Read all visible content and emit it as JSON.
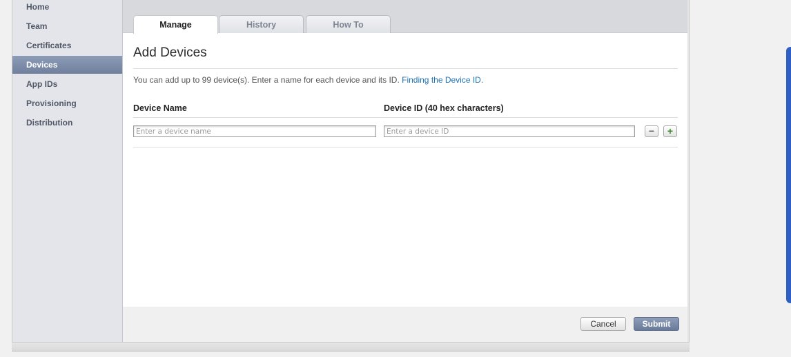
{
  "sidebar": {
    "items": [
      {
        "label": "Home",
        "active": false
      },
      {
        "label": "Team",
        "active": false
      },
      {
        "label": "Certificates",
        "active": false
      },
      {
        "label": "Devices",
        "active": true
      },
      {
        "label": "App IDs",
        "active": false
      },
      {
        "label": "Provisioning",
        "active": false
      },
      {
        "label": "Distribution",
        "active": false
      }
    ]
  },
  "tabs": [
    {
      "label": "Manage",
      "active": true
    },
    {
      "label": "History",
      "active": false
    },
    {
      "label": "How To",
      "active": false
    }
  ],
  "page": {
    "title": "Add Devices",
    "help_text": "You can add up to 99 device(s). Enter a name for each device and its ID. ",
    "help_link": "Finding the Device ID",
    "help_after": "."
  },
  "form": {
    "device_name_header": "Device Name",
    "device_id_header": "Device ID (40 hex characters)",
    "device_name_placeholder": "Enter a device name",
    "device_id_placeholder": "Enter a device ID",
    "device_name_value": "",
    "device_id_value": "",
    "remove_symbol": "−",
    "add_symbol": "+"
  },
  "footer": {
    "cancel_label": "Cancel",
    "submit_label": "Submit"
  },
  "colors": {
    "accent": "#6f7f9d",
    "link": "#1d72b8",
    "add_green": "#3a8a2a"
  }
}
